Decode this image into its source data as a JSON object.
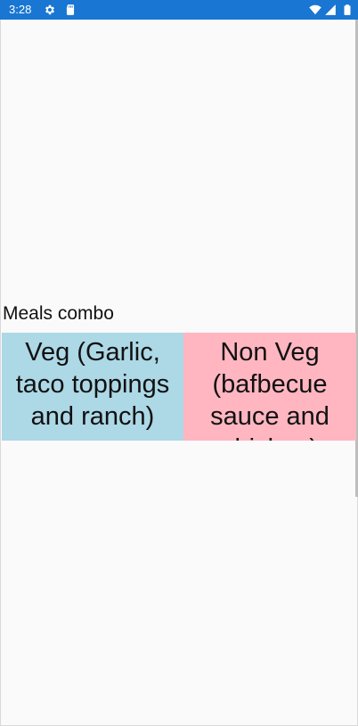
{
  "status_bar": {
    "time": "3:28",
    "left_icons": [
      "gear-icon",
      "sd-card-icon"
    ],
    "right_icons": [
      "wifi-icon",
      "cell-signal-icon",
      "battery-icon"
    ],
    "background_color": "#1976d2"
  },
  "main": {
    "section_title": "Meals combo",
    "combos": [
      {
        "label": "Veg (Garlic, taco toppings and ranch)",
        "background_color": "#add8e6"
      },
      {
        "label": "Non Veg (bafbecue sauce and chicken)",
        "background_color": "#ffb6c1"
      }
    ]
  }
}
